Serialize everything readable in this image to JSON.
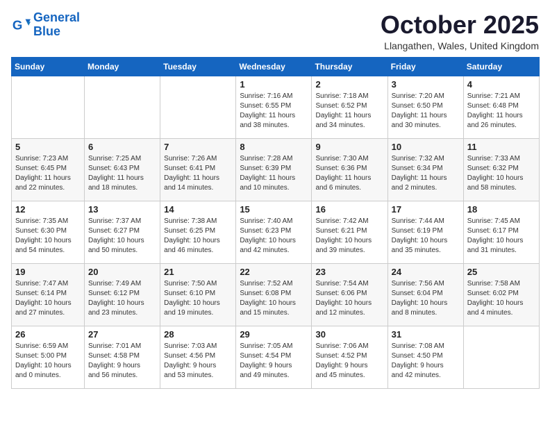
{
  "header": {
    "logo_line1": "General",
    "logo_line2": "Blue",
    "month": "October 2025",
    "location": "Llangathen, Wales, United Kingdom"
  },
  "days_of_week": [
    "Sunday",
    "Monday",
    "Tuesday",
    "Wednesday",
    "Thursday",
    "Friday",
    "Saturday"
  ],
  "weeks": [
    [
      {
        "day": "",
        "content": ""
      },
      {
        "day": "",
        "content": ""
      },
      {
        "day": "",
        "content": ""
      },
      {
        "day": "1",
        "content": "Sunrise: 7:16 AM\nSunset: 6:55 PM\nDaylight: 11 hours\nand 38 minutes."
      },
      {
        "day": "2",
        "content": "Sunrise: 7:18 AM\nSunset: 6:52 PM\nDaylight: 11 hours\nand 34 minutes."
      },
      {
        "day": "3",
        "content": "Sunrise: 7:20 AM\nSunset: 6:50 PM\nDaylight: 11 hours\nand 30 minutes."
      },
      {
        "day": "4",
        "content": "Sunrise: 7:21 AM\nSunset: 6:48 PM\nDaylight: 11 hours\nand 26 minutes."
      }
    ],
    [
      {
        "day": "5",
        "content": "Sunrise: 7:23 AM\nSunset: 6:45 PM\nDaylight: 11 hours\nand 22 minutes."
      },
      {
        "day": "6",
        "content": "Sunrise: 7:25 AM\nSunset: 6:43 PM\nDaylight: 11 hours\nand 18 minutes."
      },
      {
        "day": "7",
        "content": "Sunrise: 7:26 AM\nSunset: 6:41 PM\nDaylight: 11 hours\nand 14 minutes."
      },
      {
        "day": "8",
        "content": "Sunrise: 7:28 AM\nSunset: 6:39 PM\nDaylight: 11 hours\nand 10 minutes."
      },
      {
        "day": "9",
        "content": "Sunrise: 7:30 AM\nSunset: 6:36 PM\nDaylight: 11 hours\nand 6 minutes."
      },
      {
        "day": "10",
        "content": "Sunrise: 7:32 AM\nSunset: 6:34 PM\nDaylight: 11 hours\nand 2 minutes."
      },
      {
        "day": "11",
        "content": "Sunrise: 7:33 AM\nSunset: 6:32 PM\nDaylight: 10 hours\nand 58 minutes."
      }
    ],
    [
      {
        "day": "12",
        "content": "Sunrise: 7:35 AM\nSunset: 6:30 PM\nDaylight: 10 hours\nand 54 minutes."
      },
      {
        "day": "13",
        "content": "Sunrise: 7:37 AM\nSunset: 6:27 PM\nDaylight: 10 hours\nand 50 minutes."
      },
      {
        "day": "14",
        "content": "Sunrise: 7:38 AM\nSunset: 6:25 PM\nDaylight: 10 hours\nand 46 minutes."
      },
      {
        "day": "15",
        "content": "Sunrise: 7:40 AM\nSunset: 6:23 PM\nDaylight: 10 hours\nand 42 minutes."
      },
      {
        "day": "16",
        "content": "Sunrise: 7:42 AM\nSunset: 6:21 PM\nDaylight: 10 hours\nand 39 minutes."
      },
      {
        "day": "17",
        "content": "Sunrise: 7:44 AM\nSunset: 6:19 PM\nDaylight: 10 hours\nand 35 minutes."
      },
      {
        "day": "18",
        "content": "Sunrise: 7:45 AM\nSunset: 6:17 PM\nDaylight: 10 hours\nand 31 minutes."
      }
    ],
    [
      {
        "day": "19",
        "content": "Sunrise: 7:47 AM\nSunset: 6:14 PM\nDaylight: 10 hours\nand 27 minutes."
      },
      {
        "day": "20",
        "content": "Sunrise: 7:49 AM\nSunset: 6:12 PM\nDaylight: 10 hours\nand 23 minutes."
      },
      {
        "day": "21",
        "content": "Sunrise: 7:50 AM\nSunset: 6:10 PM\nDaylight: 10 hours\nand 19 minutes."
      },
      {
        "day": "22",
        "content": "Sunrise: 7:52 AM\nSunset: 6:08 PM\nDaylight: 10 hours\nand 15 minutes."
      },
      {
        "day": "23",
        "content": "Sunrise: 7:54 AM\nSunset: 6:06 PM\nDaylight: 10 hours\nand 12 minutes."
      },
      {
        "day": "24",
        "content": "Sunrise: 7:56 AM\nSunset: 6:04 PM\nDaylight: 10 hours\nand 8 minutes."
      },
      {
        "day": "25",
        "content": "Sunrise: 7:58 AM\nSunset: 6:02 PM\nDaylight: 10 hours\nand 4 minutes."
      }
    ],
    [
      {
        "day": "26",
        "content": "Sunrise: 6:59 AM\nSunset: 5:00 PM\nDaylight: 10 hours\nand 0 minutes."
      },
      {
        "day": "27",
        "content": "Sunrise: 7:01 AM\nSunset: 4:58 PM\nDaylight: 9 hours\nand 56 minutes."
      },
      {
        "day": "28",
        "content": "Sunrise: 7:03 AM\nSunset: 4:56 PM\nDaylight: 9 hours\nand 53 minutes."
      },
      {
        "day": "29",
        "content": "Sunrise: 7:05 AM\nSunset: 4:54 PM\nDaylight: 9 hours\nand 49 minutes."
      },
      {
        "day": "30",
        "content": "Sunrise: 7:06 AM\nSunset: 4:52 PM\nDaylight: 9 hours\nand 45 minutes."
      },
      {
        "day": "31",
        "content": "Sunrise: 7:08 AM\nSunset: 4:50 PM\nDaylight: 9 hours\nand 42 minutes."
      },
      {
        "day": "",
        "content": ""
      }
    ]
  ]
}
